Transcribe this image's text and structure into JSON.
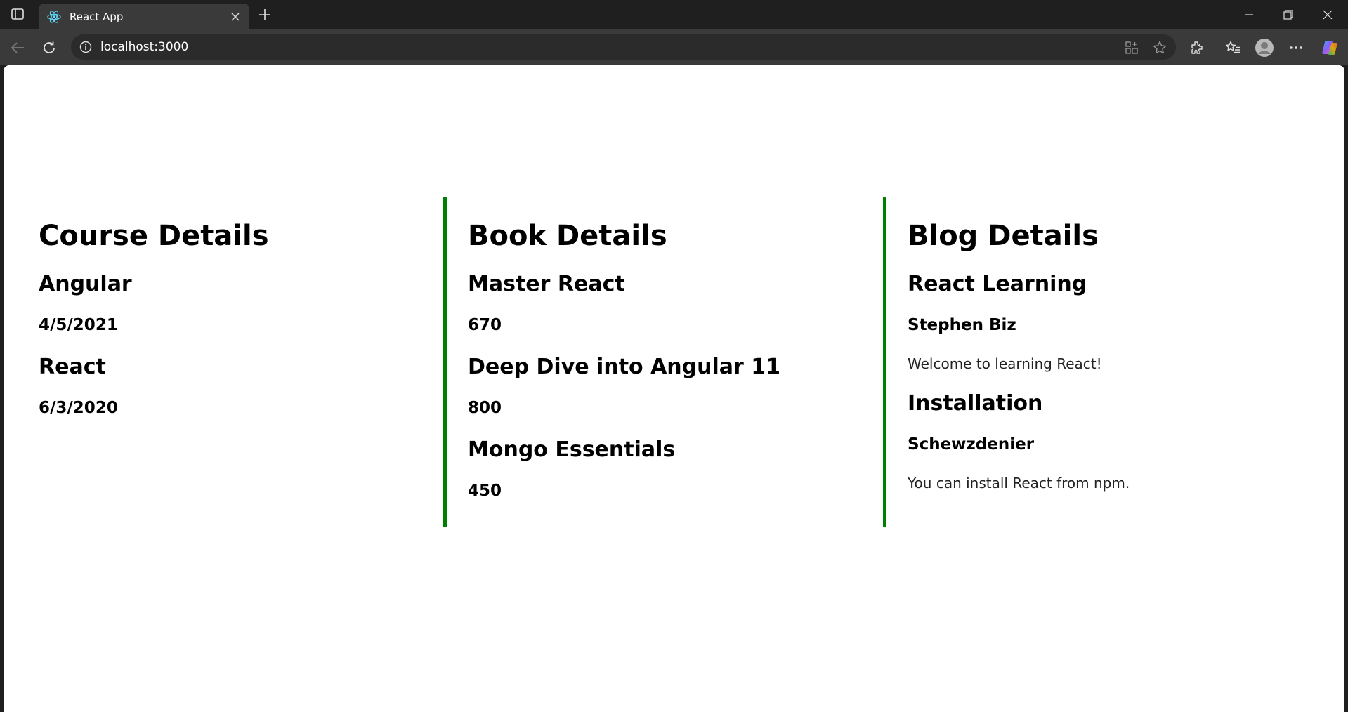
{
  "browser": {
    "tab_title": "React App",
    "url": "localhost:3000",
    "colors": {
      "accent_border": "#008000",
      "react_logo": "#61dafb"
    }
  },
  "courses": {
    "heading": "Course Details",
    "items": [
      {
        "name": "Angular",
        "date": "4/5/2021"
      },
      {
        "name": "React",
        "date": "6/3/2020"
      }
    ]
  },
  "books": {
    "heading": "Book Details",
    "items": [
      {
        "name": "Master React",
        "price": "670"
      },
      {
        "name": "Deep Dive into Angular 11",
        "price": "800"
      },
      {
        "name": "Mongo Essentials",
        "price": "450"
      }
    ]
  },
  "blogs": {
    "heading": "Blog Details",
    "items": [
      {
        "title": "React Learning",
        "author": "Stephen Biz",
        "content": "Welcome to learning React!"
      },
      {
        "title": "Installation",
        "author": "Schewzdenier",
        "content": "You can install React from npm."
      }
    ]
  }
}
